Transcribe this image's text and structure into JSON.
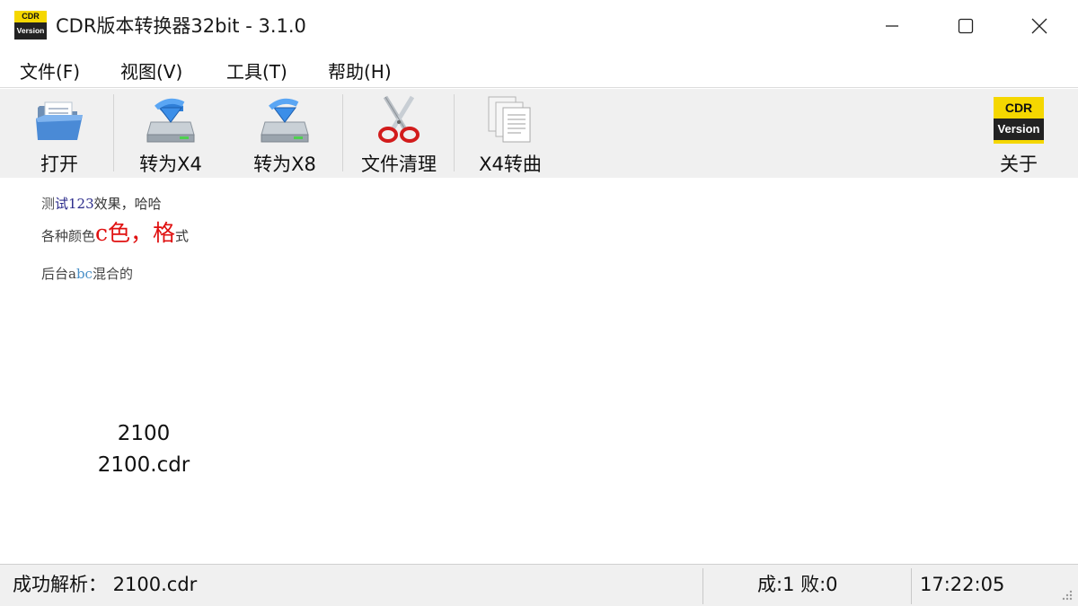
{
  "window": {
    "title": "CDR版本转换器32bit - 3.1.0",
    "logo_top": "CDR",
    "logo_bottom": "Version"
  },
  "menu": {
    "items": [
      {
        "label": "文件(F)"
      },
      {
        "label": "视图(V)"
      },
      {
        "label": "工具(T)"
      },
      {
        "label": "帮助(H)"
      }
    ]
  },
  "toolbar": {
    "open_label": "打开",
    "to_x4_label": "转为X4",
    "to_x8_label": "转为X8",
    "clean_label": "文件清理",
    "x4_curve_label": "X4转曲",
    "about_label": "关于",
    "about_logo_top": "CDR",
    "about_logo_bottom": "Version"
  },
  "preview": {
    "line1_a": "测",
    "line1_b": "试123",
    "line1_c": "效果，哈哈",
    "line2_a": "各种颜色",
    "line2_b": "c色，格",
    "line2_c": "式",
    "line3_a": "后台a",
    "line3_b": "bc",
    "line3_c": "混合的"
  },
  "file": {
    "name": "2100",
    "filename": "2100.cdr"
  },
  "status": {
    "message": "成功解析：  2100.cdr",
    "counts": "成:1  败:0",
    "time": "17:22:05"
  },
  "colors": {
    "toolbar_bg": "#f0f0f0",
    "status_bg": "#f0f0f0",
    "accent_red": "#e01010",
    "logo_yellow": "#f5d700"
  }
}
